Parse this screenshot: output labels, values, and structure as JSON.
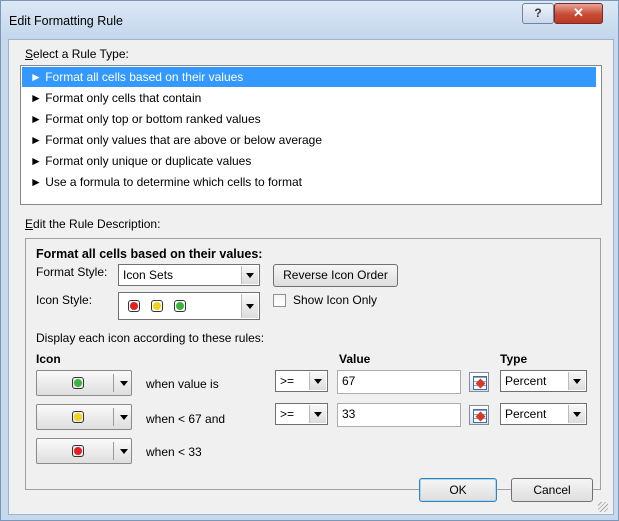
{
  "dialog": {
    "title": "Edit Formatting Rule",
    "help_label": "?",
    "close_label": "✕"
  },
  "rule_type": {
    "heading": "Select a Rule Type:",
    "items": [
      {
        "label": "► Format all cells based on their values",
        "selected": true
      },
      {
        "label": "► Format only cells that contain",
        "selected": false
      },
      {
        "label": "► Format only top or bottom ranked values",
        "selected": false
      },
      {
        "label": "► Format only values that are above or below average",
        "selected": false
      },
      {
        "label": "► Format only unique or duplicate values",
        "selected": false
      },
      {
        "label": "► Use a formula to determine which cells to format",
        "selected": false
      }
    ]
  },
  "description": {
    "heading": "Edit the Rule Description:",
    "panel_title": "Format all cells based on their values:",
    "format_style_label": "Format Style:",
    "format_style_value": "Icon Sets",
    "reverse_button": "Reverse Icon Order",
    "icon_style_label": "Icon Style:",
    "icon_style_icons": [
      "red",
      "yellow",
      "green"
    ],
    "show_icon_only_label": "Show Icon Only",
    "show_icon_only_checked": false,
    "rules_caption": "Display each icon according to these rules:",
    "col_icon": "Icon",
    "col_value": "Value",
    "col_type": "Type",
    "rows": [
      {
        "icon": "green",
        "condition": "when value is",
        "operator": ">=",
        "value": "67",
        "type": "Percent"
      },
      {
        "icon": "yellow",
        "condition": "when < 67 and",
        "operator": ">=",
        "value": "33",
        "type": "Percent"
      },
      {
        "icon": "red",
        "condition": "when < 33",
        "operator": "",
        "value": "",
        "type": ""
      }
    ]
  },
  "buttons": {
    "ok": "OK",
    "cancel": "Cancel"
  },
  "colors": {
    "red": "#e02020",
    "yellow": "#f2d21a",
    "green": "#3cb43c",
    "selection": "#3399ff"
  }
}
